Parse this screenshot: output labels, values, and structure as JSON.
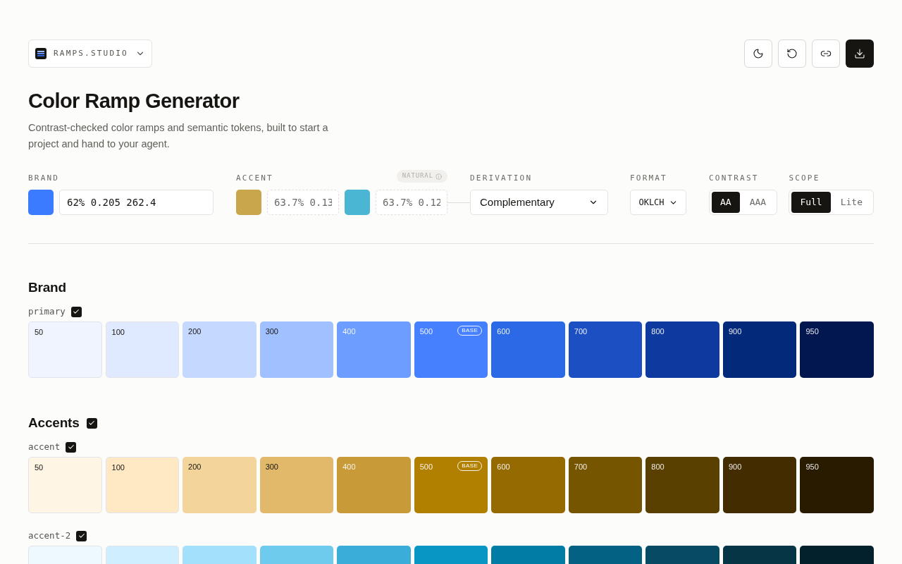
{
  "brand_menu": {
    "label": "RAMPS.STUDIO"
  },
  "toolbar": [
    {
      "kind": "theme"
    },
    {
      "kind": "reset"
    },
    {
      "kind": "link"
    },
    {
      "kind": "download"
    }
  ],
  "title": "Color Ramp Generator",
  "description": "Contrast-checked color ramps and semantic tokens, built to start a project and hand to your agent.",
  "controls": {
    "brand": {
      "label": "BRAND",
      "color": "#3b7bff",
      "value": "62% 0.205 262.4"
    },
    "accent": {
      "label": "ACCENT",
      "badge": "NATURAL",
      "inputs": [
        {
          "color": "#c9a64c",
          "value": "63.7% 0.13"
        },
        {
          "color": "#4bb5d4",
          "value": "63.7% 0.12"
        }
      ]
    },
    "derivation": {
      "label": "DERIVATION",
      "value": "Complementary"
    },
    "format": {
      "label": "FORMAT",
      "value": "OKLCH"
    },
    "contrast": {
      "label": "CONTRAST",
      "options": [
        {
          "label": "AA",
          "selected": true
        },
        {
          "label": "AAA",
          "selected": false
        }
      ]
    },
    "scope": {
      "label": "SCOPE",
      "options": [
        {
          "label": "Full",
          "selected": true
        },
        {
          "label": "Lite",
          "selected": false
        }
      ]
    }
  },
  "sections": [
    {
      "title": "Brand",
      "ramps": [
        {
          "name": "primary",
          "checked": true,
          "swatches": [
            {
              "label": "50",
              "color": "#eff4ff",
              "base": false
            },
            {
              "label": "100",
              "color": "#dfe9ff",
              "base": false
            },
            {
              "label": "200",
              "color": "#c5d8ff",
              "base": false
            },
            {
              "label": "300",
              "color": "#a0c0ff",
              "base": false
            },
            {
              "label": "400",
              "color": "#6d9eff",
              "base": false
            },
            {
              "label": "500",
              "color": "#4680ff",
              "base": true,
              "badge": "BASE"
            },
            {
              "label": "600",
              "color": "#2c69e6",
              "base": false
            },
            {
              "label": "700",
              "color": "#1c50c2",
              "base": false
            },
            {
              "label": "800",
              "color": "#0e3a9f",
              "base": false
            },
            {
              "label": "900",
              "color": "#03297a",
              "base": false
            },
            {
              "label": "950",
              "color": "#021650",
              "base": false
            }
          ]
        }
      ]
    },
    {
      "title": "Accents",
      "checked": true,
      "ramps": [
        {
          "name": "accent",
          "checked": true,
          "swatches": [
            {
              "label": "50",
              "color": "#fff5e5",
              "base": false
            },
            {
              "label": "100",
              "color": "#ffe8c4",
              "base": false
            },
            {
              "label": "200",
              "color": "#f3d49b",
              "base": false
            },
            {
              "label": "300",
              "color": "#e2b96b",
              "base": false
            },
            {
              "label": "400",
              "color": "#c99a38",
              "base": false
            },
            {
              "label": "500",
              "color": "#b28000",
              "base": true,
              "badge": "BASE"
            },
            {
              "label": "600",
              "color": "#956a00",
              "base": false
            },
            {
              "label": "700",
              "color": "#765500",
              "base": false
            },
            {
              "label": "800",
              "color": "#5a4000",
              "base": false
            },
            {
              "label": "900",
              "color": "#432d00",
              "base": false
            },
            {
              "label": "950",
              "color": "#281b00",
              "base": false
            }
          ]
        },
        {
          "name": "accent-2",
          "checked": true,
          "swatches": [
            {
              "color": "#eef8ff"
            },
            {
              "color": "#cfeeff"
            },
            {
              "color": "#a3e0fb"
            },
            {
              "color": "#6fcbee"
            },
            {
              "color": "#3aaed9"
            },
            {
              "color": "#0896c4"
            },
            {
              "color": "#007ca5"
            },
            {
              "color": "#036283"
            },
            {
              "color": "#064a63"
            },
            {
              "color": "#063546"
            },
            {
              "color": "#03212d"
            }
          ]
        }
      ]
    }
  ]
}
